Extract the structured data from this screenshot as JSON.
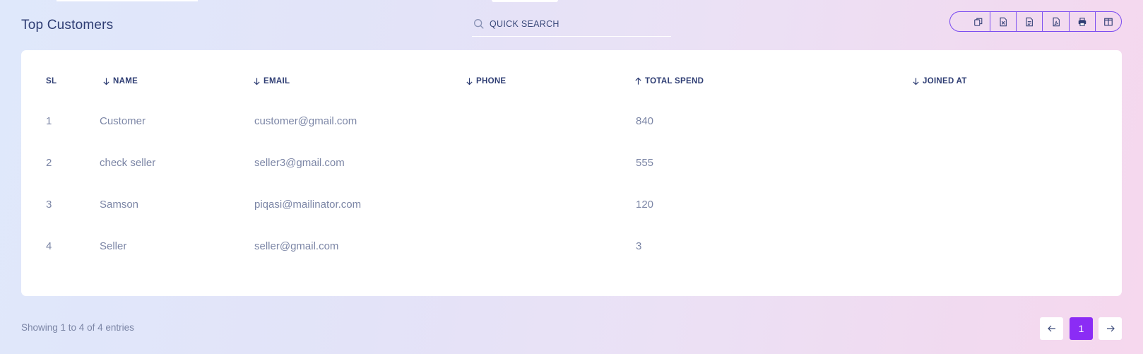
{
  "header": {
    "title": "Top Customers",
    "search_placeholder": "QUICK SEARCH"
  },
  "toolbar": {
    "buttons": [
      "copy-icon",
      "excel-icon",
      "csv-icon",
      "pdf-icon",
      "print-icon",
      "columns-icon"
    ]
  },
  "table": {
    "columns": [
      {
        "label": "SL",
        "sort": "none"
      },
      {
        "label": "NAME",
        "sort": "down"
      },
      {
        "label": "EMAIL",
        "sort": "down"
      },
      {
        "label": "PHONE",
        "sort": "down"
      },
      {
        "label": "TOTAL SPEND",
        "sort": "up"
      },
      {
        "label": "JOINED AT",
        "sort": "down"
      }
    ],
    "rows": [
      {
        "sl": "1",
        "name": "Customer",
        "email": "customer@gmail.com",
        "phone": "",
        "total_spend": "840",
        "joined_at": ""
      },
      {
        "sl": "2",
        "name": "check seller",
        "email": "seller3@gmail.com",
        "phone": "",
        "total_spend": "555",
        "joined_at": ""
      },
      {
        "sl": "3",
        "name": "Samson",
        "email": "piqasi@mailinator.com",
        "phone": "",
        "total_spend": "120",
        "joined_at": ""
      },
      {
        "sl": "4",
        "name": "Seller",
        "email": "seller@gmail.com",
        "phone": "",
        "total_spend": "3",
        "joined_at": ""
      }
    ]
  },
  "footer": {
    "entries_text": "Showing 1 to 4 of 4 entries",
    "current_page": "1"
  },
  "colors": {
    "accent": "#8b2cf5",
    "toolbar_border": "#7a4cf0",
    "heading": "#2e3d73",
    "muted_text": "#7c86a6"
  }
}
